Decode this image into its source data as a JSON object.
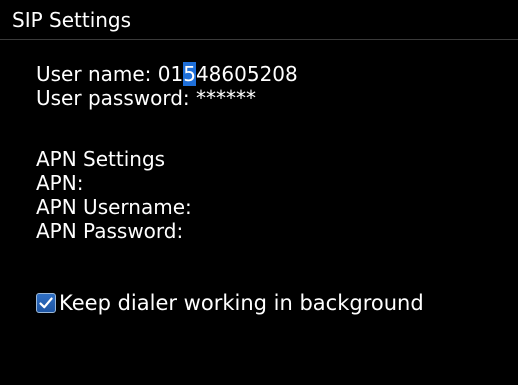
{
  "screen": {
    "title": "SIP Settings"
  },
  "sip": {
    "user_name_label": "User name:",
    "user_name_value_before_cursor": "01",
    "user_name_cursor_char": "5",
    "user_name_value_after_cursor": "48605208",
    "user_password_label": "User password:",
    "user_password_value": "******"
  },
  "apn": {
    "section_heading": "APN Settings",
    "apn_label": "APN:",
    "apn_value": "",
    "username_label": "APN Username:",
    "username_value": "",
    "password_label": "APN Password:",
    "password_value": ""
  },
  "options": {
    "keep_dialer_label": "Keep dialer working in background",
    "keep_dialer_checked": true
  },
  "colors": {
    "background": "#000000",
    "text": "#ffffff",
    "cursor_highlight": "#1e6fd9",
    "checkbox_fill": "#1e55a3"
  }
}
